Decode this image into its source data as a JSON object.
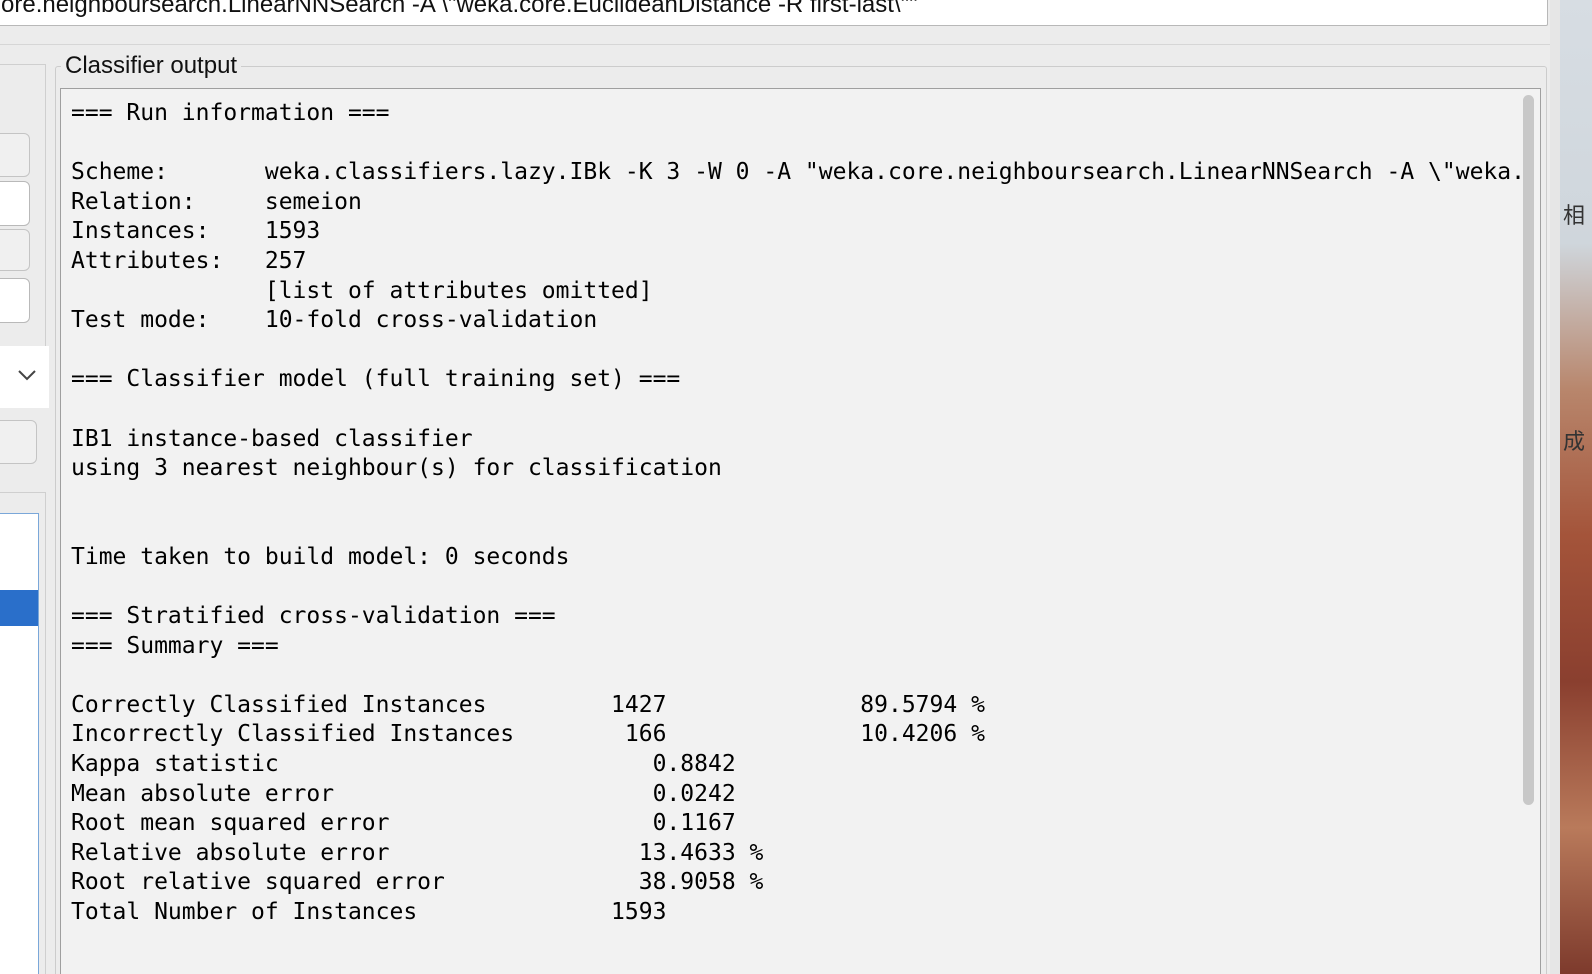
{
  "command": {
    "text": "ore.neighboursearch.LinearNNSearch -A \\\"weka.core.EuclideanDistance -R first-last\\\"\""
  },
  "classifier_output": {
    "title": "Classifier output",
    "run_information_header": "=== Run information ===",
    "run_info": [
      {
        "label": "Scheme:",
        "value": "weka.classifiers.lazy.IBk -K 3 -W 0 -A \"weka.core.neighboursearch.LinearNNSearch -A \\\"weka."
      },
      {
        "label": "Relation:",
        "value": "semeion"
      },
      {
        "label": "Instances:",
        "value": "1593"
      },
      {
        "label": "Attributes:",
        "value": "257"
      },
      {
        "label": "",
        "value": "[list of attributes omitted]"
      },
      {
        "label": "Test mode:",
        "value": "10-fold cross-validation"
      }
    ],
    "model_header": "=== Classifier model (full training set) ===",
    "model_lines": [
      "IB1 instance-based classifier",
      "using 3 nearest neighbour(s) for classification"
    ],
    "time_taken": "Time taken to build model: 0 seconds",
    "cv_header": "=== Stratified cross-validation ===",
    "summary_header": "=== Summary ===",
    "summary": [
      {
        "label": "Correctly Classified Instances",
        "value": "1427",
        "percent": "89.5794 %"
      },
      {
        "label": "Incorrectly Classified Instances",
        "value": "166",
        "percent": "10.4206 %"
      },
      {
        "label": "Kappa statistic",
        "value": "0.8842",
        "percent": ""
      },
      {
        "label": "Mean absolute error",
        "value": "0.0242",
        "percent": ""
      },
      {
        "label": "Root mean squared error",
        "value": "0.1167",
        "percent": ""
      },
      {
        "label": "Relative absolute error",
        "value": "13.4633 %",
        "percent": ""
      },
      {
        "label": "Root relative squared error",
        "value": "38.9058 %",
        "percent": ""
      },
      {
        "label": "Total Number of Instances",
        "value": "1593",
        "percent": ""
      }
    ]
  },
  "desktop": {
    "glyph_1": "相",
    "glyph_2": "成"
  },
  "colors": {
    "selection": "#2a6fca",
    "panel_bg": "#ececec",
    "output_bg": "#f2f2f2"
  }
}
